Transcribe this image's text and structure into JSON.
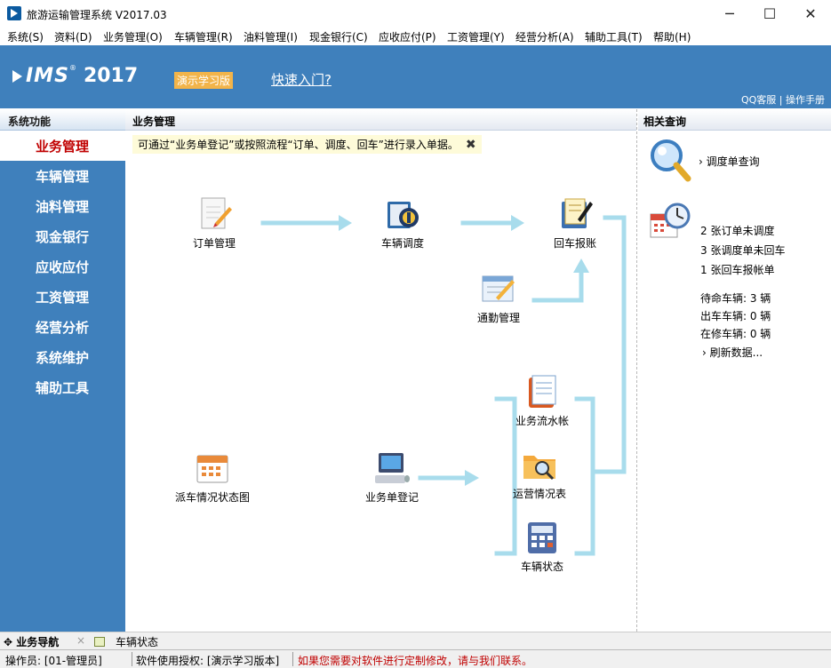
{
  "window": {
    "title": "旅游运输管理系统 V2017.03",
    "minimize_glyph": "─",
    "maximize_glyph": "☐",
    "close_glyph": "✕"
  },
  "menu": [
    "系统(S)",
    "资料(D)",
    "业务管理(O)",
    "车辆管理(R)",
    "油料管理(I)",
    "现金银行(C)",
    "应收应付(P)",
    "工资管理(Y)",
    "经营分析(A)",
    "辅助工具(T)",
    "帮助(H)"
  ],
  "banner": {
    "logo_text": "IMS",
    "logo_mark": "®",
    "year": "2017",
    "demo_badge": "演示学习版",
    "quick_link": "快速入门?",
    "service_links": "QQ客服 | 操作手册"
  },
  "sidebar": {
    "header": "系统功能",
    "items": [
      "业务管理",
      "车辆管理",
      "油料管理",
      "现金银行",
      "应收应付",
      "工资管理",
      "经营分析",
      "系统维护",
      "辅助工具"
    ],
    "active_index": 0
  },
  "main": {
    "header": "业务管理",
    "tip": "可通过“业务单登记”或按照流程“订单、调度、回车”进行录入单据。",
    "tip_close_glyph": "✖",
    "nodes": {
      "order": "订单管理",
      "dispatch": "车辆调度",
      "return": "回车报账",
      "commute": "通勤管理",
      "ledger": "业务流水帐",
      "ops_report": "运营情况表",
      "vehicle_status": "车辆状态",
      "dispatch_chart": "派车情况状态图",
      "business_register": "业务单登记"
    }
  },
  "right_panel": {
    "header": "相关查询",
    "query_link": "调度单查询",
    "pending": [
      "2 张订单未调度",
      "3 张调度单未回车",
      "1 张回车报帐单"
    ],
    "vehicle_stats": [
      "待命车辆: 3 辆",
      "出车车辆: 0 辆",
      "在修车辆: 0 辆"
    ],
    "refresh_link": "刷新数据..."
  },
  "bottom_tabs": {
    "nav": "业务导航",
    "nav_close": "×",
    "vehicle_status": "车辆状态"
  },
  "statusbar": {
    "operator": "操作员: [01-管理员]",
    "license": "软件使用授权: [演示学习版本]",
    "notice": "如果您需要对软件进行定制修改，请与我们联系。"
  },
  "colors": {
    "banner_blue": "#3f80bc",
    "active_red": "#c00000",
    "demo_badge": "#f2b44a",
    "flow_line": "#a8dcec",
    "notice_red": "#c00000"
  }
}
